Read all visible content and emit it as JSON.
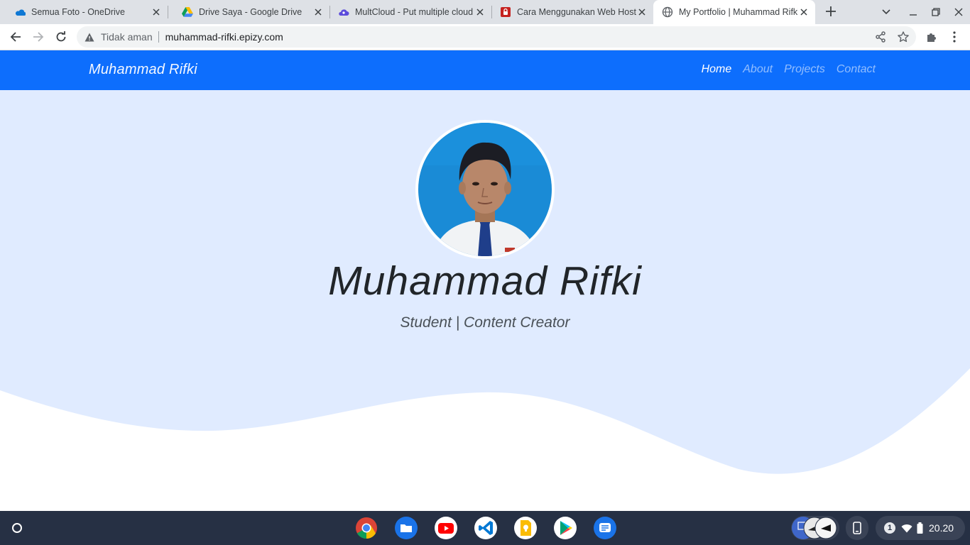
{
  "browser": {
    "tabs": [
      {
        "title": "Semua Foto - OneDrive",
        "icon": "onedrive-icon",
        "active": false
      },
      {
        "title": "Drive Saya - Google Drive",
        "icon": "google-drive-icon",
        "active": false
      },
      {
        "title": "MultCloud - Put multiple cloud",
        "icon": "multcloud-icon",
        "active": false
      },
      {
        "title": "Cara Menggunakan Web Host",
        "icon": "lock-favicon-icon",
        "active": false
      },
      {
        "title": "My Portfolio | Muhammad Rifki",
        "icon": "globe-icon",
        "active": true
      }
    ],
    "security_label": "Tidak aman",
    "url": "muhammad-rifki.epizy.com"
  },
  "page": {
    "brand": "Muhammad Rifki",
    "nav": [
      {
        "label": "Home",
        "active": true
      },
      {
        "label": "About",
        "active": false
      },
      {
        "label": "Projects",
        "active": false
      },
      {
        "label": "Contact",
        "active": false
      }
    ],
    "hero": {
      "name": "Muhammad Rifki",
      "subtitle": "Student | Content Creator"
    },
    "colors": {
      "navbar": "#0d6efd",
      "hero_bg": "#e0ebff"
    }
  },
  "shelf": {
    "apps": [
      "chrome-icon",
      "files-icon",
      "youtube-icon",
      "vscode-icon",
      "keep-icon",
      "play-store-icon",
      "messages-icon"
    ],
    "notification_count": "1",
    "clock": "20.20"
  }
}
